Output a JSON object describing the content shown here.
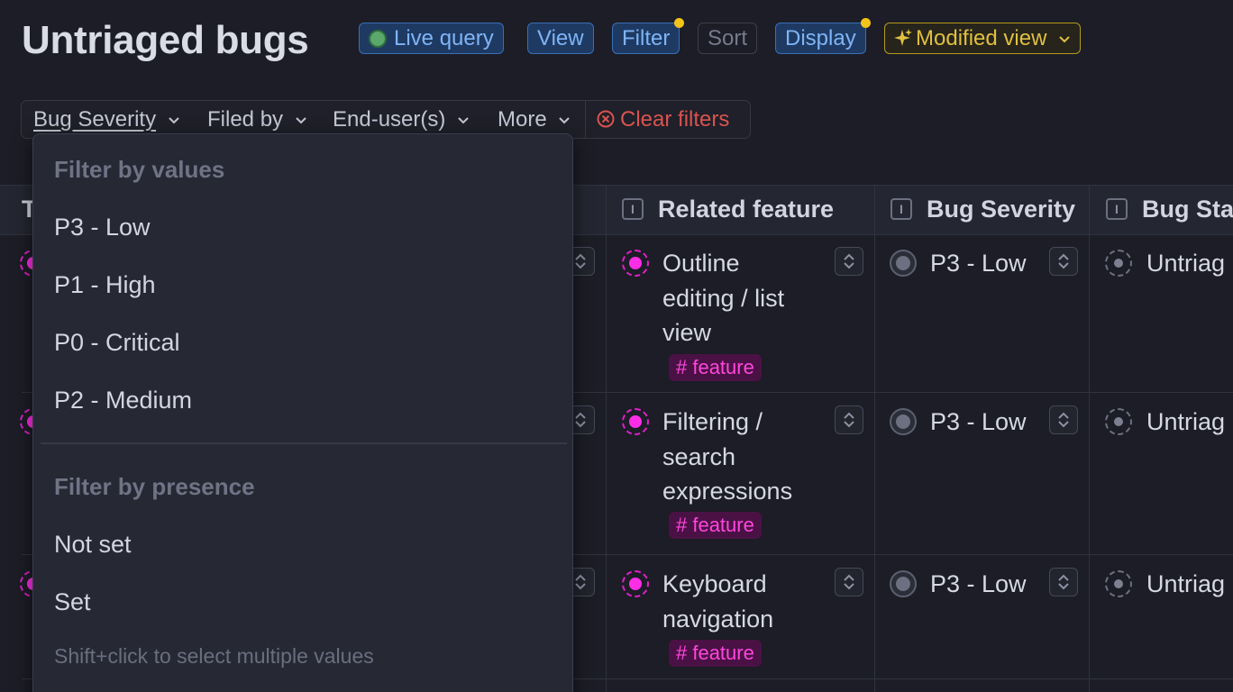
{
  "page": {
    "title": "Untriaged bugs"
  },
  "toolbar": {
    "live_query": "Live query",
    "view": "View",
    "filter": "Filter",
    "sort": "Sort",
    "display": "Display",
    "modified_view": "Modified view"
  },
  "filters": {
    "bug_severity": "Bug Severity",
    "filed_by": "Filed by",
    "end_users": "End-user(s)",
    "more": "More",
    "clear": "Clear filters"
  },
  "columns": {
    "first_partial": "T",
    "related_feature": "Related feature",
    "bug_severity": "Bug Severity",
    "bug_status_partial": "Bug Sta"
  },
  "rows": [
    {
      "feature_lines": [
        "Outline",
        "editing / list",
        "view"
      ],
      "tag": "# feature",
      "severity": "P3 - Low",
      "status": "Untriag"
    },
    {
      "feature_lines": [
        "Filtering /",
        "search",
        "expressions"
      ],
      "tag": "# feature",
      "severity": "P3 - Low",
      "status": "Untriag"
    },
    {
      "feature_lines": [
        "Keyboard",
        "navigation"
      ],
      "tag": "# feature",
      "severity": "P3 - Low",
      "status": "Untriag"
    }
  ],
  "dropdown": {
    "values_heading": "Filter by values",
    "values": [
      "P3 - Low",
      "P1 - High",
      "P0 - Critical",
      "P2 - Medium"
    ],
    "presence_heading": "Filter by presence",
    "presence": [
      "Not set",
      "Set"
    ],
    "hint": "Shift+click to select multiple values"
  },
  "colors": {
    "background": "#1c1d26",
    "accent_blue": "#7fb4f5",
    "accent_yellow": "#e0c040",
    "feature_pink": "#ff2ee6",
    "danger": "#d9534f"
  }
}
